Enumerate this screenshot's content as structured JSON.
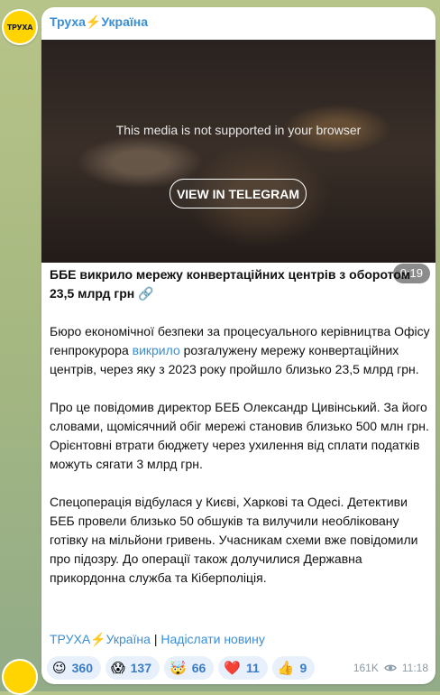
{
  "avatar": {
    "logo_text": "ТРУХА"
  },
  "channel": {
    "name": "Труха⚡Україна"
  },
  "media": {
    "message": "This media is not supported in your browser",
    "button": "VIEW IN TELEGRAM",
    "duration": "0:19"
  },
  "post": {
    "headline": "ББЕ викрило мережу конвертаційних центрів з оборотом 23,5 млрд грн 🔗",
    "p1_a": "Бюро економічної безпеки за процесуального керівництва Офісу генпрокурора ",
    "p1_link": "викрило",
    "p1_b": " розгалужену мережу конвертаційних центрів, через яку з 2023 року пройшло близько 23,5 млрд грн.",
    "p2": "Про це повідомив директор БЕБ Олександр Цивінський. За його словами, щомісячний обіг мережі становив близько 500 млн грн. Орієнтовні втрати бюджету через ухилення від сплати податків можуть сягати 3 млрд грн.",
    "p3": "Спецоперація відбулася у Києві, Харкові та Одесі. Детективи БЕБ провели близько 50 обшуків та вилучили необліковану готівку на мільйони гривень. Учасникам схеми вже повідомили про підозру. До операції також долучилися Державна прикордонна служба та Кіберполіція."
  },
  "footer": {
    "link1": "ТРУХА⚡Україна",
    "separator": " | ",
    "link2": "Надіслати новину"
  },
  "reactions": [
    {
      "emoji": "😉",
      "count": "360"
    },
    {
      "emoji": "😱",
      "count": "137"
    },
    {
      "emoji": "🤯",
      "count": "66"
    },
    {
      "emoji": "❤️",
      "count": "11"
    },
    {
      "emoji": "👍",
      "count": "9"
    }
  ],
  "meta": {
    "views": "161K",
    "time": "11:18"
  },
  "colors": {
    "accent": "#3a8ed6",
    "reaction_bg": "#e8f0fb",
    "logo_bg": "#ffd400"
  }
}
